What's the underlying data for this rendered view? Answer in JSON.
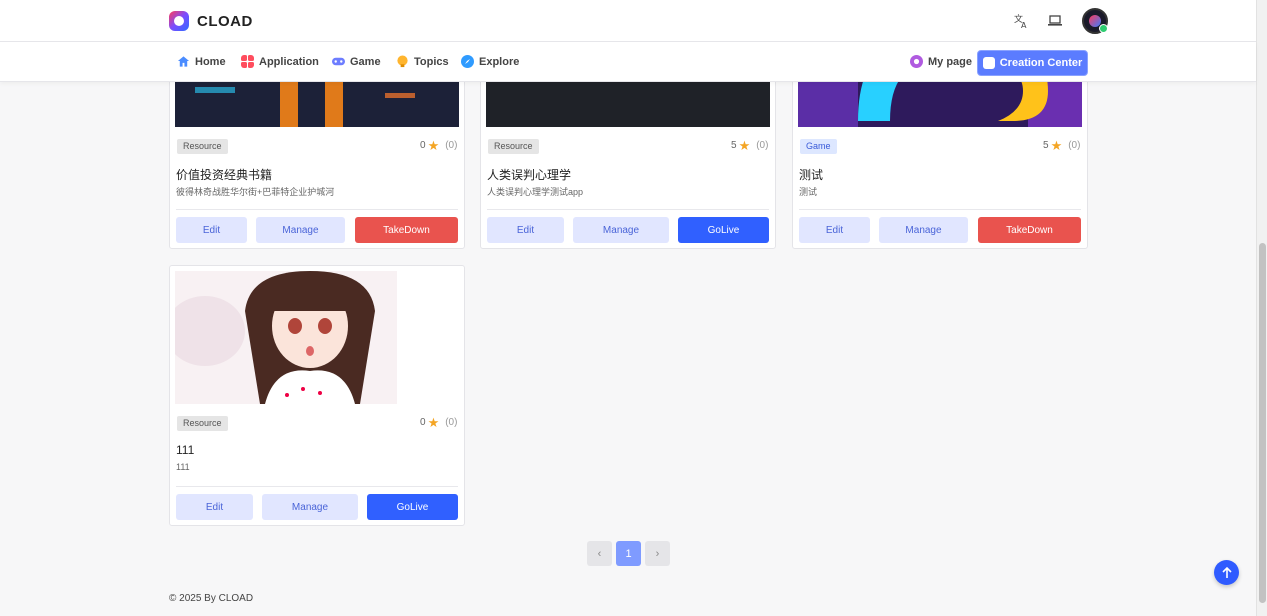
{
  "brand": {
    "name": "CLOAD"
  },
  "nav": {
    "items": [
      {
        "label": "Home",
        "icon": "home-icon"
      },
      {
        "label": "Application",
        "icon": "grid-icon"
      },
      {
        "label": "Game",
        "icon": "gamepad-icon"
      },
      {
        "label": "Topics",
        "icon": "lightbulb-icon"
      },
      {
        "label": "Explore",
        "icon": "compass-icon"
      }
    ],
    "my_page": "My page",
    "creation_center": "Creation Center"
  },
  "header_icons": [
    "translate-icon",
    "laptop-icon",
    "avatar"
  ],
  "cards": [
    {
      "tag": "Resource",
      "rating": "0",
      "count": "(0)",
      "title": "价值投资经典书籍",
      "desc": "彼得林奇战胜华尔街+巴菲特企业护城河",
      "buttons": [
        "Edit",
        "Manage",
        "TakeDown"
      ],
      "status_action": "TakeDown"
    },
    {
      "tag": "Resource",
      "rating": "5",
      "count": "(0)",
      "title": "人类误判心理学",
      "desc": "人类误判心理学测试app",
      "buttons": [
        "Edit",
        "Manage",
        "GoLive"
      ],
      "status_action": "GoLive"
    },
    {
      "tag": "Game",
      "rating": "5",
      "count": "(0)",
      "title": "测试",
      "desc": "测试",
      "buttons": [
        "Edit",
        "Manage",
        "TakeDown"
      ],
      "status_action": "TakeDown"
    },
    {
      "tag": "Resource",
      "rating": "0",
      "count": "(0)",
      "title": "111",
      "desc": "111",
      "buttons": [
        "Edit",
        "Manage",
        "GoLive"
      ],
      "status_action": "GoLive"
    }
  ],
  "pagination": {
    "prev": "‹",
    "current": "1",
    "next": "›"
  },
  "footer": {
    "text": "© 2025 By CLOAD"
  },
  "colors": {
    "primary": "#3060ff",
    "danger": "#e9534e",
    "light_button": "#e1e6ff",
    "star": "#f4a524"
  }
}
